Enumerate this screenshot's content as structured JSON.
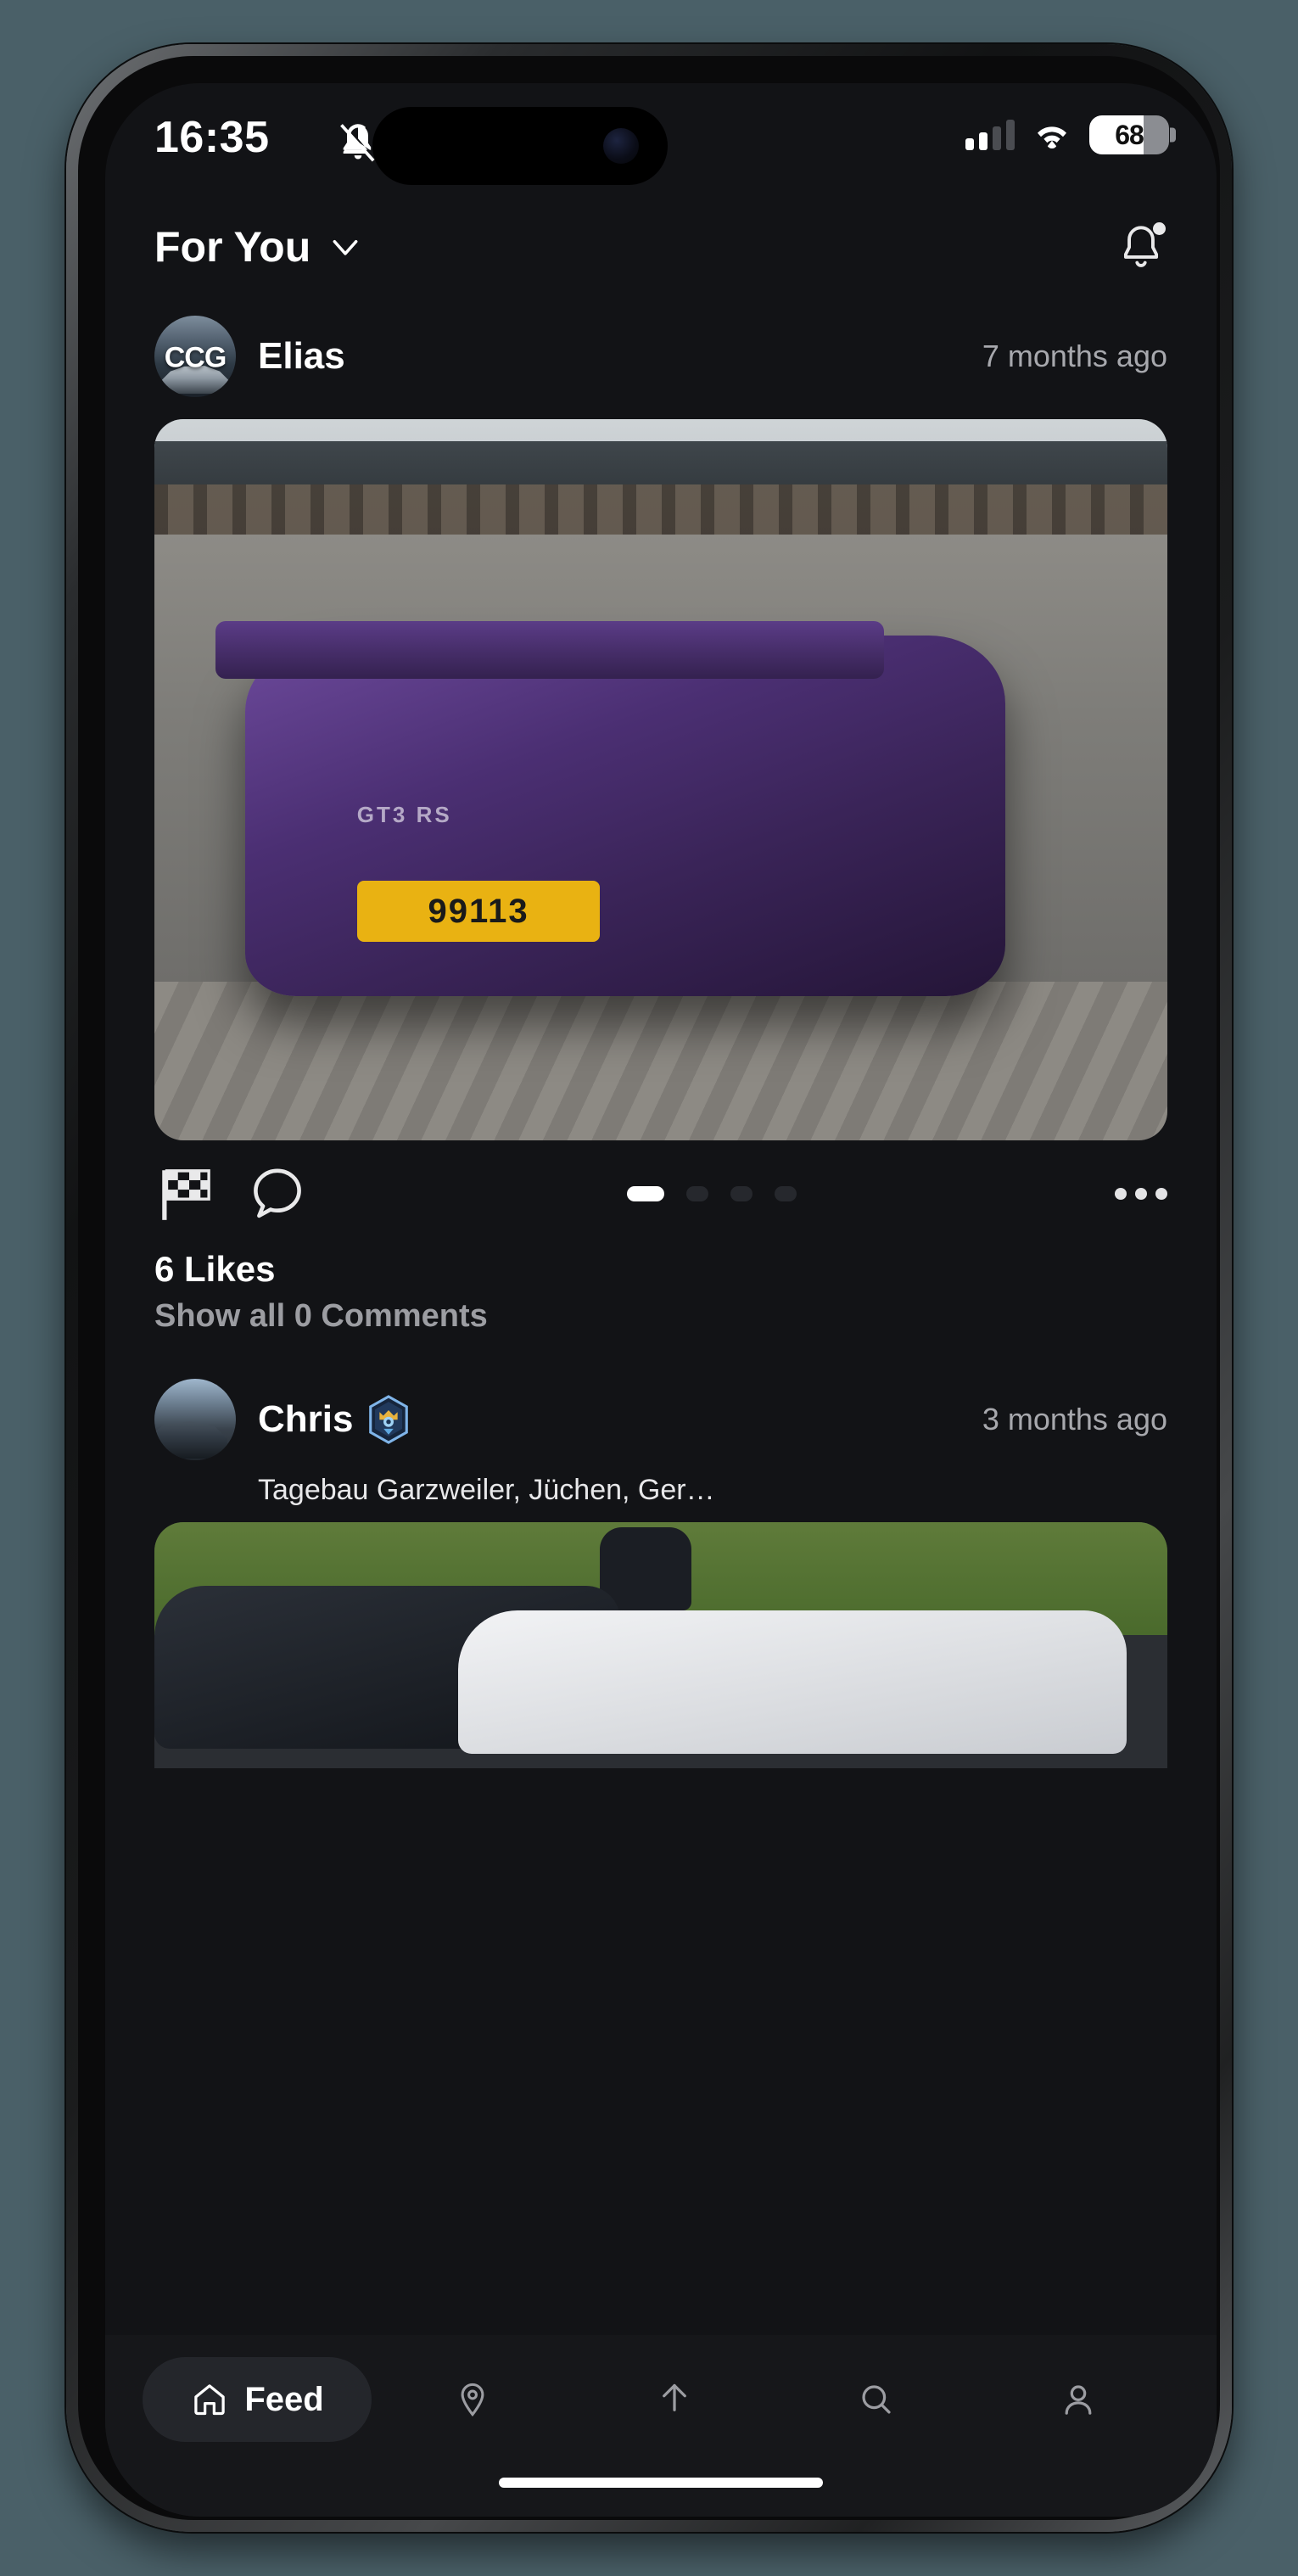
{
  "status_bar": {
    "time": "16:35",
    "silent_icon": "bell-slash-icon",
    "signal_icon": "cellular-signal-icon",
    "signal_bars_filled": 2,
    "signal_bars_total": 4,
    "wifi_icon": "wifi-icon",
    "battery_level": "68",
    "battery_percent": 68
  },
  "nav_header": {
    "feed_title": "For You",
    "chevron_icon": "chevron-down-icon",
    "bell_icon": "bell-icon",
    "has_notification": true
  },
  "posts": [
    {
      "username": "Elias",
      "avatar_label": "CCG",
      "time": "7 months ago",
      "location": "",
      "verified": false,
      "media_alt": "purple-porsche-911-gt3-rs-rear-view-parking-lot",
      "license_plate": "99113",
      "model_badge": "GT3 RS",
      "like_icon": "checkered-flag-icon",
      "comment_icon": "comment-bubble-icon",
      "more_icon": "more-options-icon",
      "page_count": 4,
      "page_active": 1,
      "likes": "6 Likes",
      "comments": "Show all 0 Comments"
    },
    {
      "username": "Chris",
      "avatar_label": "",
      "time": "3 months ago",
      "location": "Tagebau Garzweiler, Jüchen, Ger…",
      "verified": true,
      "verified_icon": "hexagon-crown-badge-icon",
      "media_alt": "black-and-white-sports-cars-on-grass-field"
    }
  ],
  "tab_bar": {
    "tabs": [
      {
        "label": "Feed",
        "icon": "home-icon",
        "active": true
      },
      {
        "label": "",
        "icon": "location-pin-icon",
        "active": false
      },
      {
        "label": "",
        "icon": "upload-icon",
        "active": false
      },
      {
        "label": "",
        "icon": "search-icon",
        "active": false
      },
      {
        "label": "",
        "icon": "profile-icon",
        "active": false
      }
    ]
  },
  "colors": {
    "screen_bg": "#121316",
    "tab_bar_bg": "#16171a",
    "accent_white": "#ffffff",
    "muted_text": "#a7a8ad"
  }
}
